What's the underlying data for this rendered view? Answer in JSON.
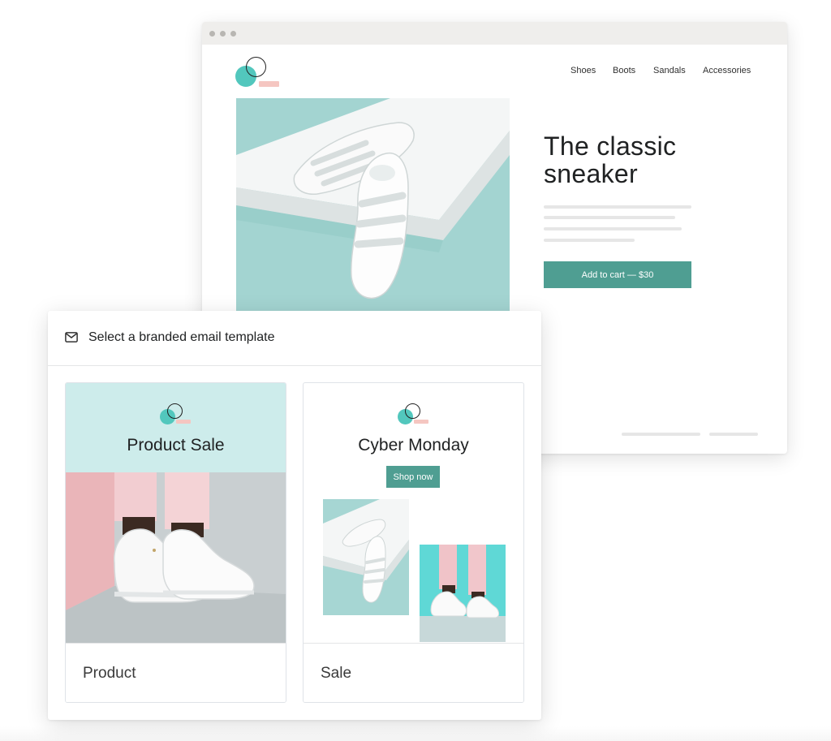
{
  "storefront": {
    "nav": {
      "items": [
        "Shoes",
        "Boots",
        "Sandals",
        "Accessories"
      ]
    },
    "hero": {
      "title_line1": "The classic",
      "title_line2": "sneaker",
      "cart_button": "Add to cart — $30"
    }
  },
  "modal": {
    "title": "Select a branded email template",
    "templates": [
      {
        "heading": "Product Sale",
        "footer": "Product"
      },
      {
        "heading": "Cyber Monday",
        "button": "Shop now",
        "footer": "Sale"
      }
    ]
  },
  "icons": {
    "modal_icon": "envelope-icon",
    "logo": "brand-logo"
  },
  "colors": {
    "accent_green": "#4f9e92",
    "logo_teal": "#52c7bd",
    "logo_pink": "#f5c6c1",
    "hero_background": "#a6d6d3",
    "card_header_background": "#cdeceb"
  }
}
